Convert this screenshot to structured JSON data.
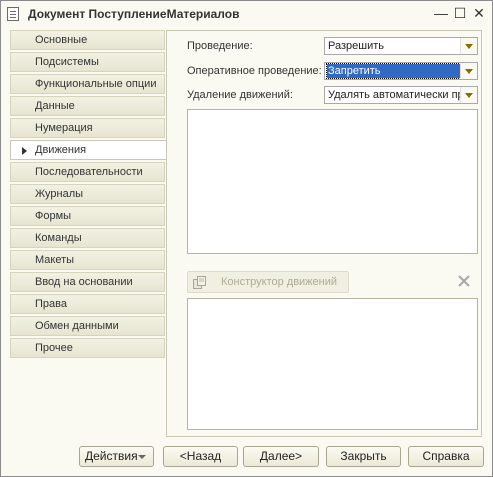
{
  "window": {
    "title": "Документ ПоступлениеМатериалов",
    "controls": {
      "minimize": "—",
      "maximize": "☐",
      "close": "✕"
    }
  },
  "sidebar": {
    "items": [
      {
        "label": "Основные"
      },
      {
        "label": "Подсистемы"
      },
      {
        "label": "Функциональные опции"
      },
      {
        "label": "Данные"
      },
      {
        "label": "Нумерация"
      },
      {
        "label": "Движения"
      },
      {
        "label": "Последовательности"
      },
      {
        "label": "Журналы"
      },
      {
        "label": "Формы"
      },
      {
        "label": "Команды"
      },
      {
        "label": "Макеты"
      },
      {
        "label": "Ввод на основании"
      },
      {
        "label": "Права"
      },
      {
        "label": "Обмен данными"
      },
      {
        "label": "Прочее"
      }
    ],
    "active_label": "Движения"
  },
  "fields": {
    "posting": {
      "label": "Проведение:",
      "value": "Разрешить"
    },
    "online_posting": {
      "label": "Оперативное проведение:",
      "value": "Запретить"
    },
    "delete_movements": {
      "label": "Удаление движений:",
      "value": "Удалять автоматически при"
    }
  },
  "constructor_button": {
    "label": "Конструктор движений"
  },
  "buttons": {
    "actions": "Действия",
    "back": "<Назад",
    "next": "Далее>",
    "close": "Закрыть",
    "help": "Справка"
  },
  "colors": {
    "background": "#fbfaf2",
    "selection": "#316ac5",
    "dropdown_arrow": "#8a6d00"
  }
}
